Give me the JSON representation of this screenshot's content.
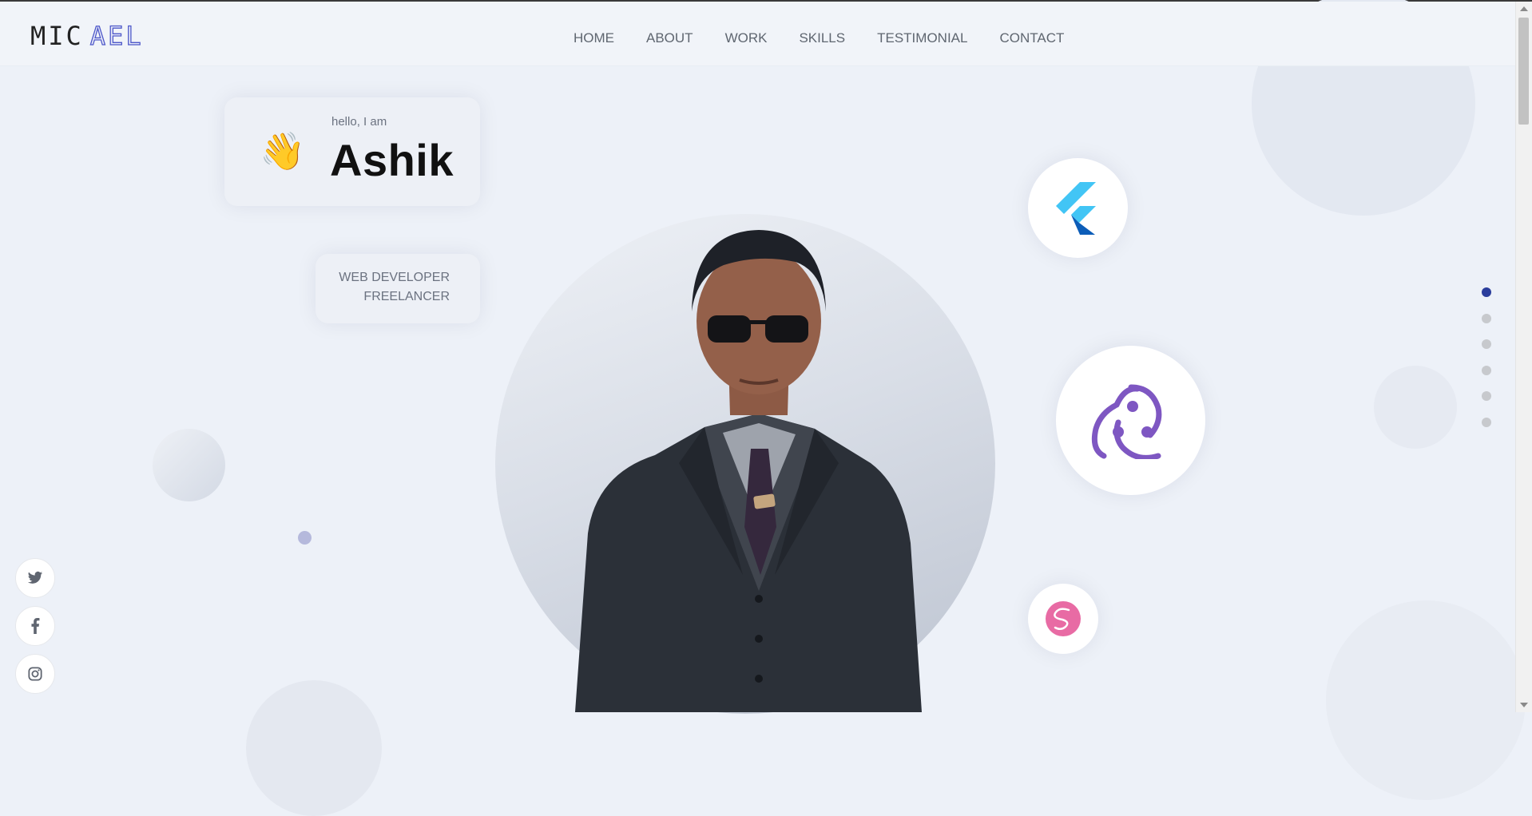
{
  "brand": {
    "logo_part1": "MIC",
    "logo_part2": "AEL"
  },
  "nav": {
    "items": [
      "HOME",
      "ABOUT",
      "WORK",
      "SKILLS",
      "TESTIMONIAL",
      "CONTACT"
    ]
  },
  "hero": {
    "greeting": "hello, I am",
    "name": "Ashik",
    "wave_emoji": "👋",
    "roles": [
      "WEB DEVELOPER",
      "FREELANCER"
    ]
  },
  "tech_icons": [
    "flutter-icon",
    "redux-icon",
    "sass-icon"
  ],
  "section_dots": {
    "count": 6,
    "active_index": 0
  },
  "social": [
    "twitter-icon",
    "facebook-icon",
    "instagram-icon"
  ],
  "colors": {
    "background": "#edf1f8",
    "accent": "#2b3d9c",
    "logo_outline": "#4e58c9",
    "flutter_light": "#42c5f5",
    "flutter_dark": "#0c5db8",
    "redux": "#7e57c2",
    "sass": "#e86ba4"
  }
}
